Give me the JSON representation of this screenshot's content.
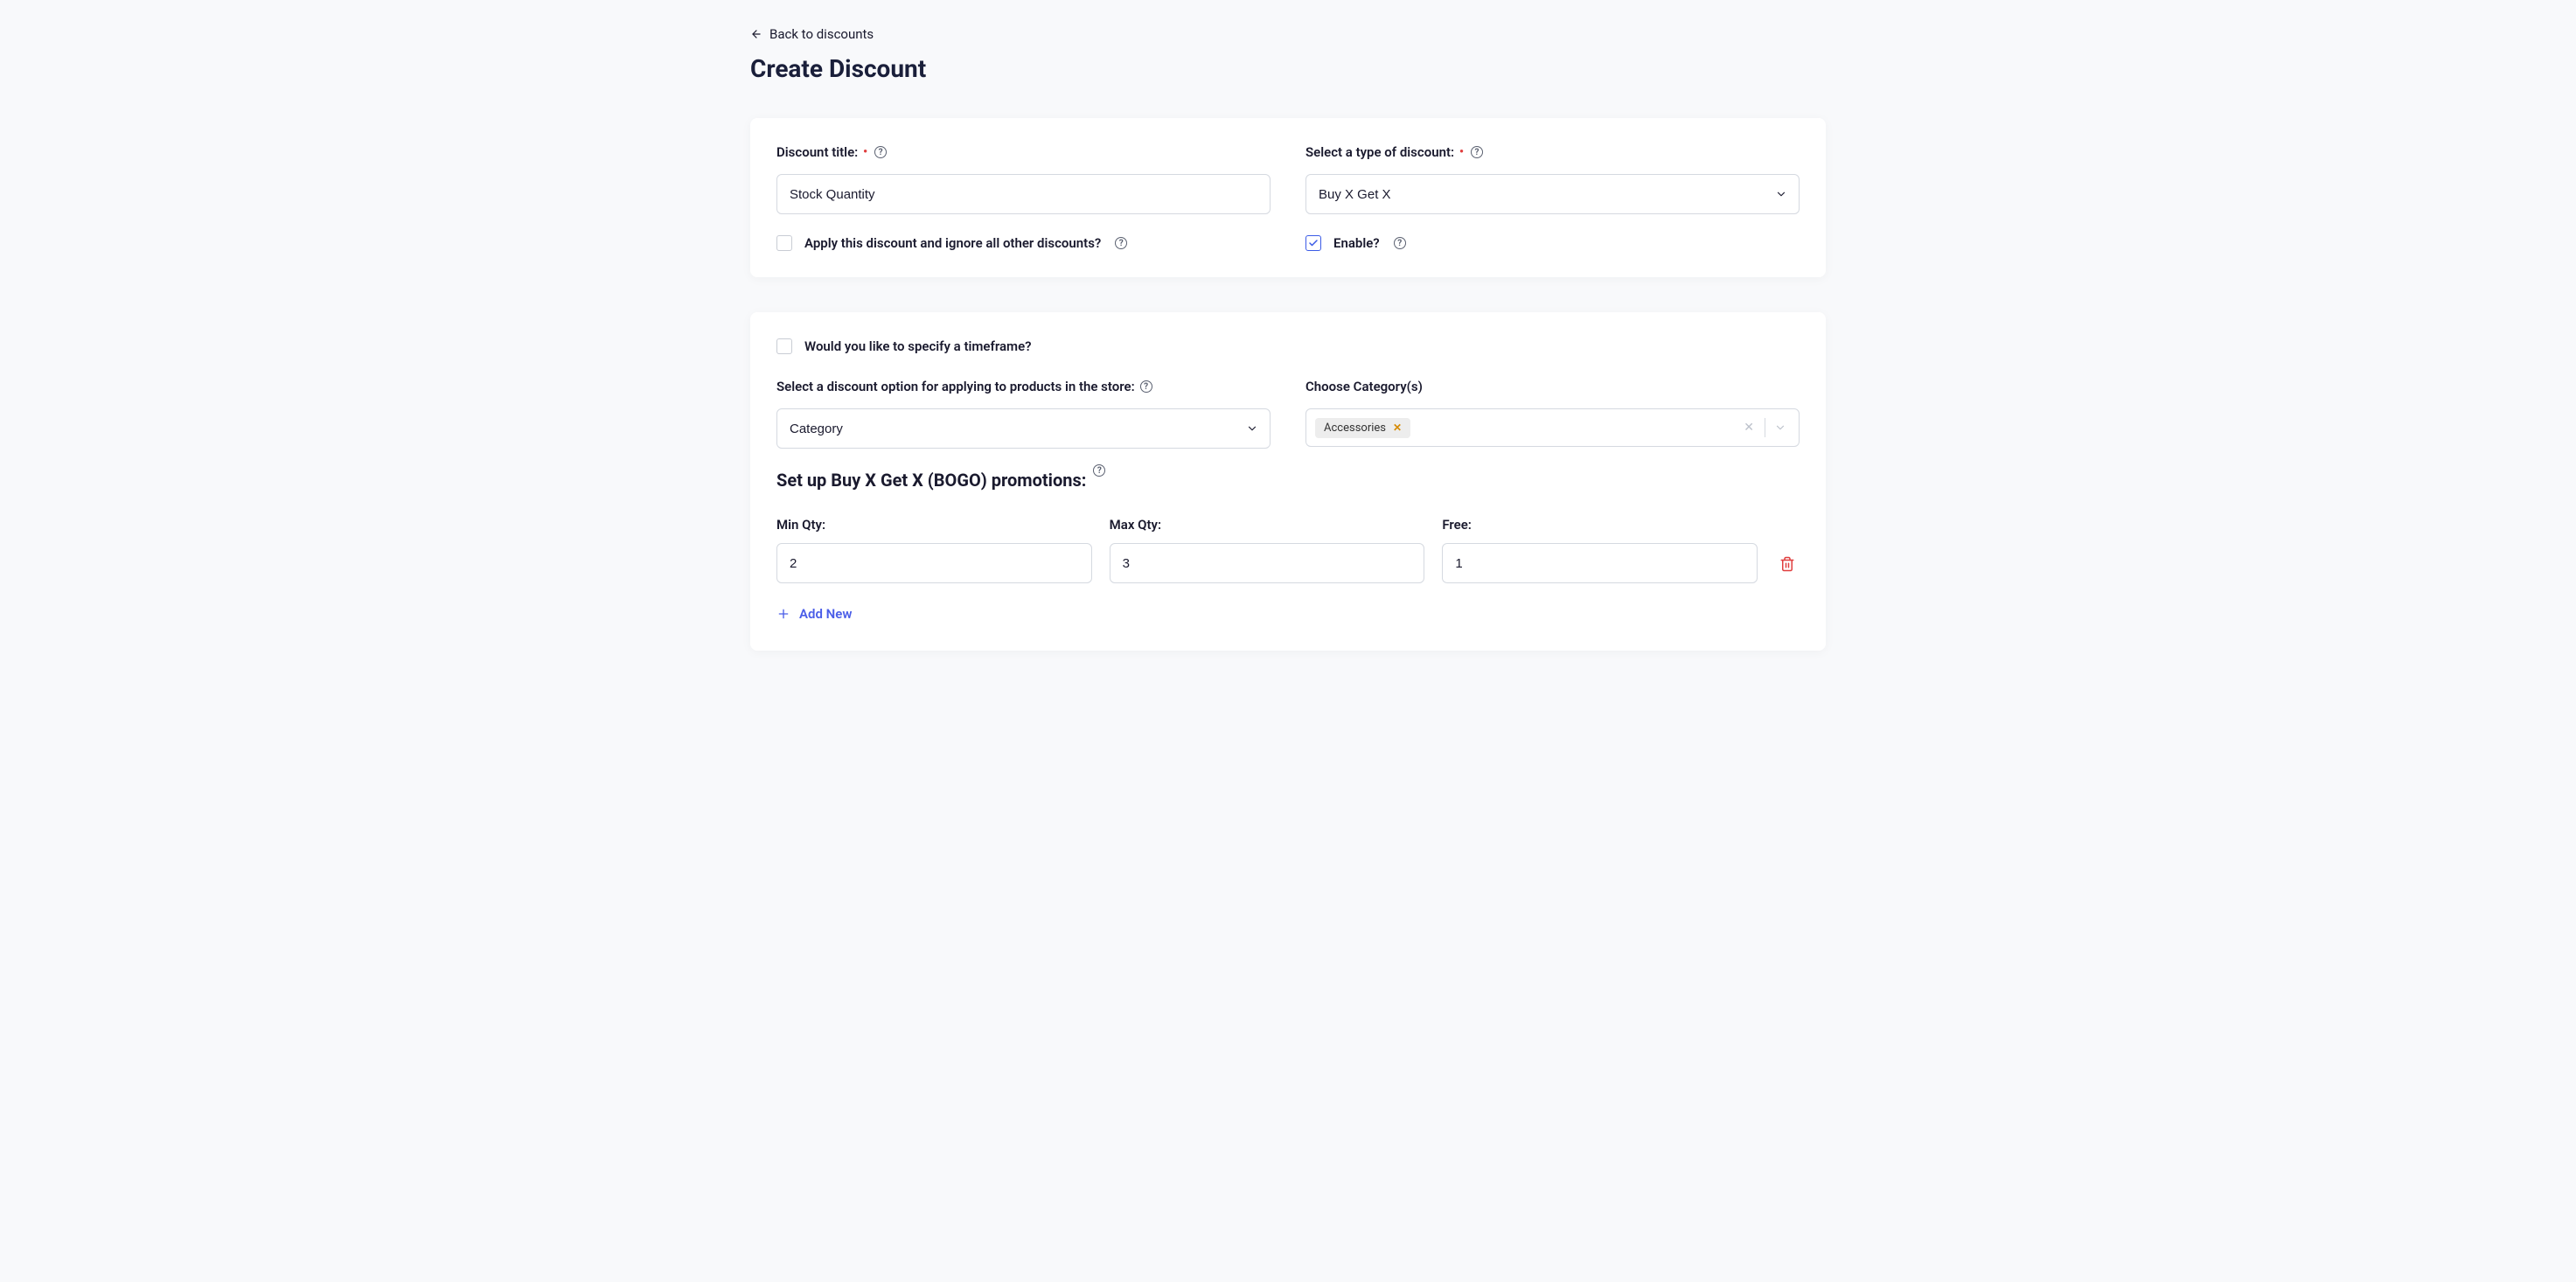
{
  "header": {
    "back_link": "Back to discounts",
    "page_title": "Create Discount"
  },
  "card1": {
    "title_label": "Discount title:",
    "title_value": "Stock Quantity",
    "type_label": "Select a type of discount:",
    "type_value": "Buy X Get X",
    "apply_ignore_label": "Apply this discount and ignore all other discounts?",
    "apply_ignore_checked": false,
    "enable_label": "Enable?",
    "enable_checked": true
  },
  "card2": {
    "timeframe_label": "Would you like to specify a timeframe?",
    "timeframe_checked": false,
    "discount_option_label": "Select a discount option for applying to products in the store:",
    "discount_option_value": "Category",
    "choose_category_label": "Choose Category(s)",
    "categories": [
      {
        "name": "Accessories"
      }
    ],
    "bogo_heading": "Set up Buy X Get X (BOGO) promotions:",
    "min_qty_label": "Min Qty:",
    "max_qty_label": "Max Qty:",
    "free_label": "Free:",
    "rows": [
      {
        "min": "2",
        "max": "3",
        "free": "1"
      }
    ],
    "add_new_label": "Add New"
  }
}
